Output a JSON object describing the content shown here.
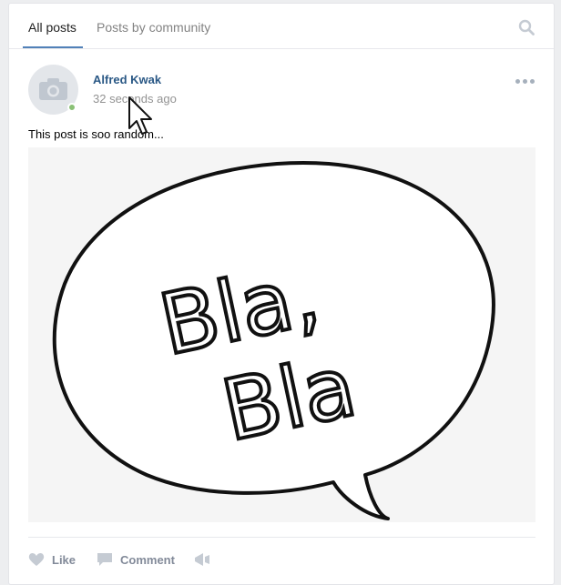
{
  "tabs": [
    {
      "label": "All posts",
      "active": true
    },
    {
      "label": "Posts by community",
      "active": false
    }
  ],
  "post": {
    "author": "Alfred Kwak",
    "time": "32 seconds ago",
    "status": "online",
    "text": "This post is soo random...",
    "image": {
      "bubble_text_line1": "Bla,",
      "bubble_text_line2": "Bla"
    }
  },
  "actions": [
    {
      "label": "Like",
      "icon": "heart-icon"
    },
    {
      "label": "Comment",
      "icon": "comment-icon"
    },
    {
      "label": "",
      "icon": "share-icon"
    }
  ],
  "colors": {
    "accent": "#5181b8",
    "link": "#2a5885",
    "online": "#8ac176",
    "muted": "#939393"
  }
}
